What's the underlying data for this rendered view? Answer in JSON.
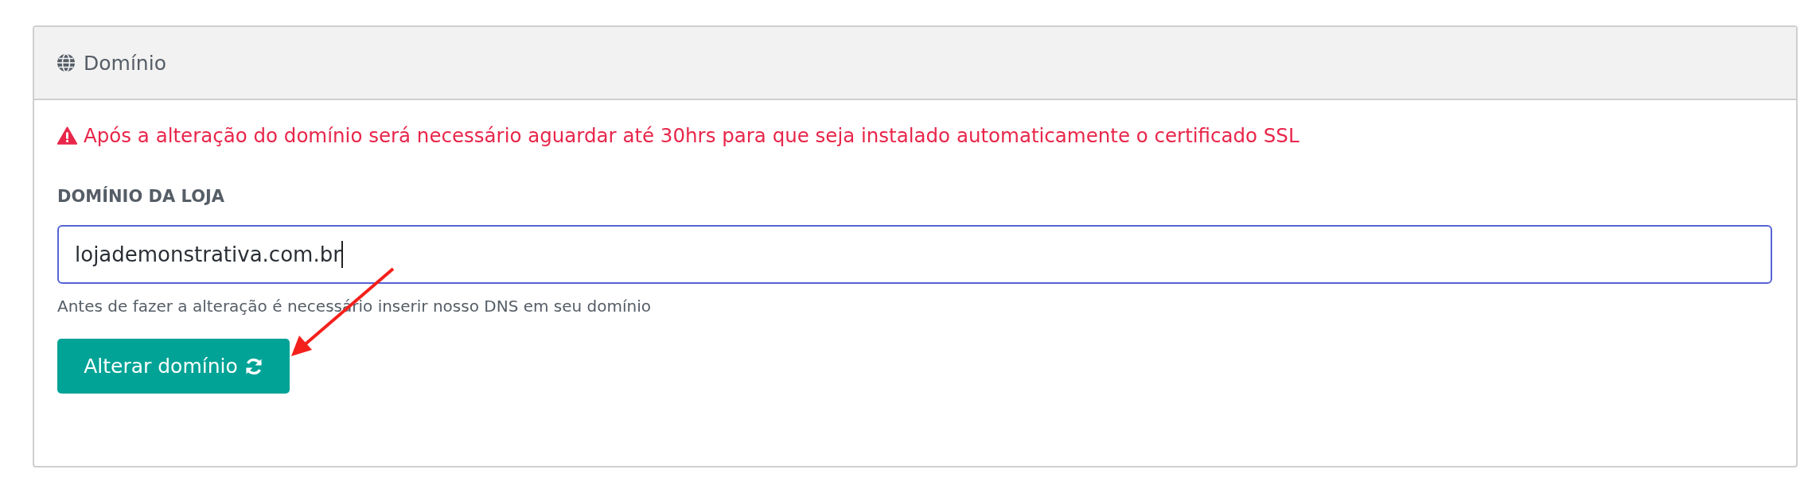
{
  "panel": {
    "title": "Domínio"
  },
  "alert": {
    "text": "Após a alteração do domínio será necessário aguardar até 30hrs para que seja instalado automaticamente o certificado SSL"
  },
  "field": {
    "label": "DOMÍNIO DA LOJA",
    "value": "lojademonstrativa.com.br",
    "focused": true,
    "help": "Antes de fazer a alteração é necessário inserir nosso DNS em seu domínio"
  },
  "button": {
    "label": "Alterar domínio"
  }
}
